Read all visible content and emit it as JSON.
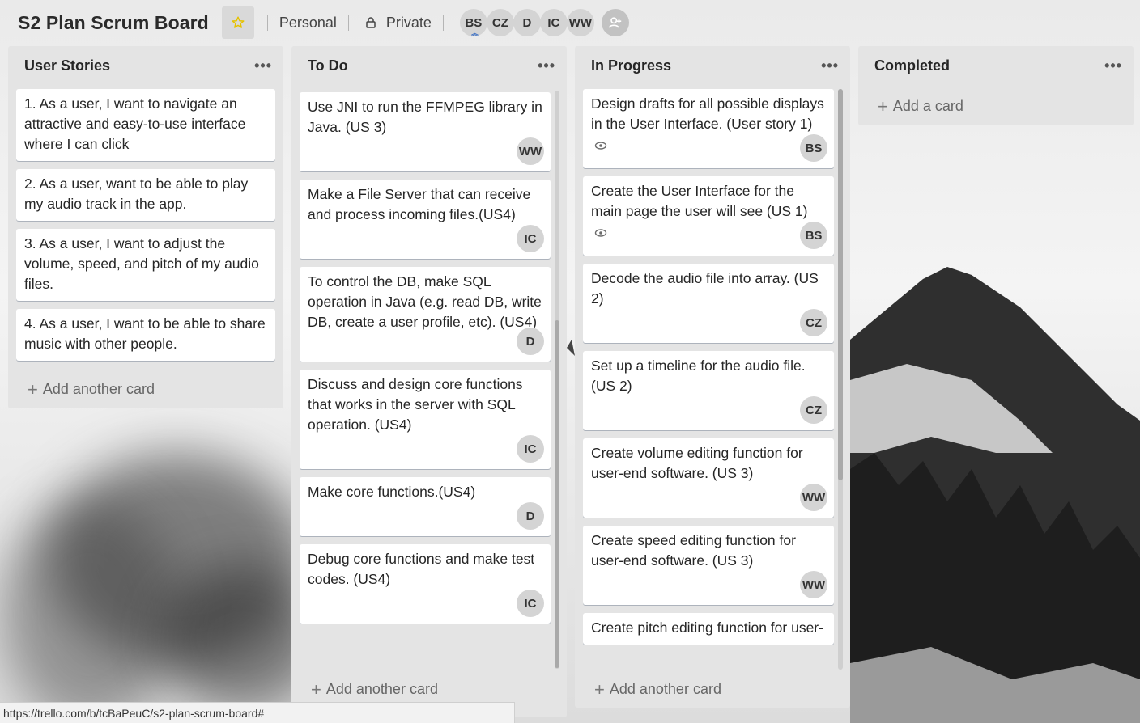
{
  "header": {
    "board_title": "S2 Plan Scrum Board",
    "team_label": "Personal",
    "visibility_label": "Private",
    "members": [
      {
        "initials": "BS",
        "admin": true
      },
      {
        "initials": "CZ",
        "admin": false
      },
      {
        "initials": "D",
        "admin": false
      },
      {
        "initials": "IC",
        "admin": false
      },
      {
        "initials": "WW",
        "admin": false
      }
    ],
    "admin_badge": "︽"
  },
  "lists": [
    {
      "title": "User Stories",
      "menu": "•••",
      "add_label": "Add another card",
      "cards": [
        {
          "text": "1. As a user, I want to navigate an attractive and easy-to-use interface where I can click"
        },
        {
          "text": "2. As a user, want to be able to play my audio track in the app."
        },
        {
          "text": "3. As a user, I want to adjust the volume, speed, and pitch of my audio files."
        },
        {
          "text": "4. As a user, I want to be able to share music with other people."
        }
      ]
    },
    {
      "title": "To Do",
      "menu": "•••",
      "add_label": "Add another card",
      "cards": [
        {
          "text": "Use JNI to run the FFMPEG library in Java. (US 3)",
          "member": "WW"
        },
        {
          "text": "Make a File Server that can receive and process incoming files.(US4)",
          "member": "IC"
        },
        {
          "text": "To control the DB, make SQL operation in Java (e.g. read DB, write DB, create a user profile, etc). (US4)",
          "member": "D"
        },
        {
          "text": "Discuss and design core functions that works in the server with SQL operation. (US4)",
          "member": "IC"
        },
        {
          "text": "Make core functions.(US4)",
          "member": "D"
        },
        {
          "text": "Debug core functions and make test codes. (US4)",
          "member": "IC"
        }
      ]
    },
    {
      "title": "In Progress",
      "menu": "•••",
      "add_label": "Add another card",
      "cards": [
        {
          "text": "Design drafts for all possible displays in the User Interface. (User story 1)",
          "member": "BS",
          "watched": true
        },
        {
          "text": "Create the User Interface for the main page the user will see (US 1)",
          "member": "BS",
          "watched": true
        },
        {
          "text": "Decode the audio file into array. (US 2)",
          "member": "CZ"
        },
        {
          "text": "Set up a timeline for the audio file. (US 2)",
          "member": "CZ"
        },
        {
          "text": "Create volume editing function for user-end software. (US 3)",
          "member": "WW"
        },
        {
          "text": "Create speed editing function for user-end software. (US 3)",
          "member": "WW"
        },
        {
          "text": "Create pitch editing function for user-"
        }
      ]
    },
    {
      "title": "Completed",
      "menu": "•••",
      "add_label": "Add a card",
      "cards": []
    }
  ],
  "status_url": "https://trello.com/b/tcBaPeuC/s2-plan-scrum-board#",
  "colors": {
    "star": "#f2d600",
    "list_bg": "#e4e4e4"
  }
}
